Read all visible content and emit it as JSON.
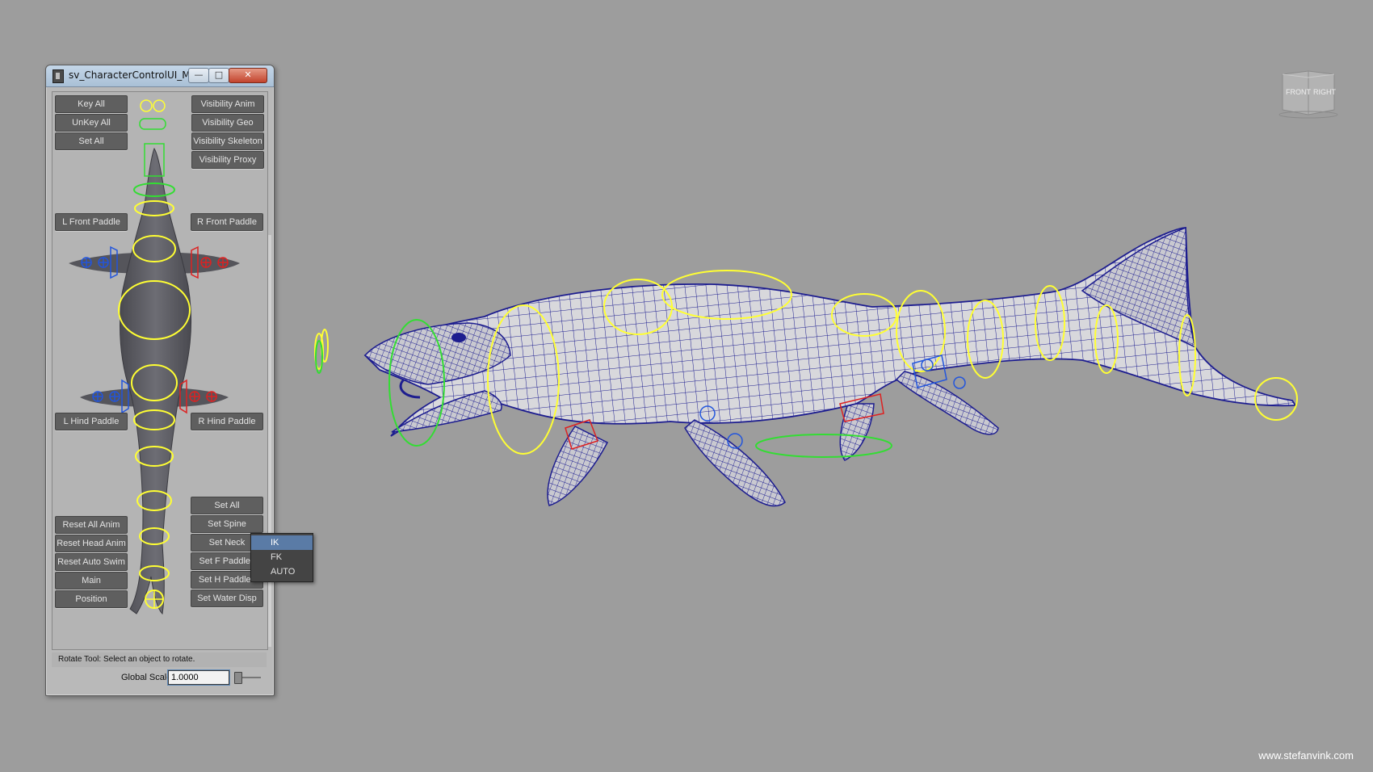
{
  "window": {
    "title": "sv_CharacterControlUI_M...",
    "min_glyph": "—",
    "max_glyph": "□",
    "close_glyph": "✕"
  },
  "buttons": {
    "key_all": "Key All",
    "unkey_all": "UnKey All",
    "set_all_top": "Set All",
    "visibility_anim": "Visibility Anim",
    "visibility_geo": "Visibility Geo",
    "visibility_skeleton": "Visibility Skeleton",
    "visibility_proxy": "Visibility Proxy",
    "l_front_paddle": "L Front Paddle",
    "r_front_paddle": "R Front Paddle",
    "l_hind_paddle": "L Hind Paddle",
    "r_hind_paddle": "R Hind Paddle",
    "set_all_bottom": "Set All",
    "set_spine": "Set Spine",
    "set_neck": "Set Neck",
    "set_f_paddles": "Set F Paddles",
    "set_h_paddles": "Set H Paddles",
    "set_water_disp": "Set Water Disp",
    "reset_all_anim": "Reset All Anim",
    "reset_head_anim": "Reset Head Anim",
    "reset_auto_swim": "Reset Auto Swim",
    "main": "Main",
    "position": "Position"
  },
  "context_menu": {
    "items": [
      "IK",
      "FK",
      "AUTO"
    ],
    "highlighted": "IK"
  },
  "status": {
    "message": "Rotate Tool: Select an object to rotate.",
    "global_scale_label": "Global Scale",
    "global_scale_value": "1.0000"
  },
  "viewcube": {
    "front": "FRONT",
    "right": "RIGHT"
  },
  "watermark": "www.stefanvink.com",
  "colors": {
    "viewport_bg": "#9d9d9d",
    "button_bg": "#5f5f5f",
    "control_yellow": "#ffff33",
    "control_green": "#33dd33",
    "control_blue": "#2255dd",
    "control_red": "#dd2222",
    "wireframe": "#1d1d8f",
    "menu_highlight": "#5a7ba6"
  }
}
